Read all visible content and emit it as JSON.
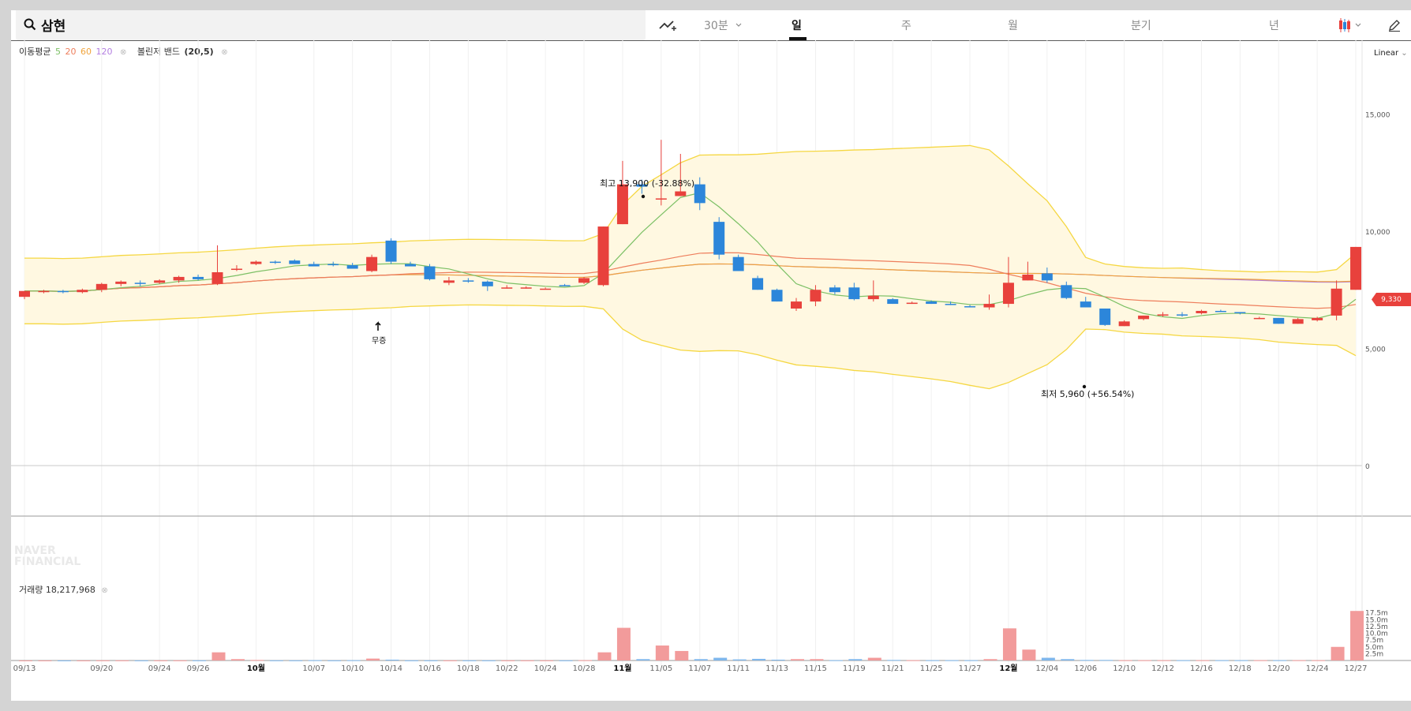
{
  "search": {
    "query": "삼현"
  },
  "toolbar": {
    "interval_label": "30분",
    "tabs": [
      "일",
      "주",
      "월",
      "분기",
      "년"
    ],
    "active_tab": "일"
  },
  "legend": {
    "ma_label": "이동평균",
    "ma_periods": [
      "5",
      "20",
      "60",
      "120"
    ],
    "ma_colors": [
      "#7cc065",
      "#ee7e5c",
      "#f0a43c",
      "#b37ee0"
    ],
    "bb_label": "볼린저 밴드",
    "bb_params": "(20,5)"
  },
  "scale_mode": "Linear",
  "price_axis_ticks": [
    "15,000",
    "10,000",
    "5,000",
    "0"
  ],
  "volume": {
    "label": "거래량",
    "value": "18,217,968"
  },
  "volume_axis_ticks": [
    "17.5m",
    "15.0m",
    "12.5m",
    "10.0m",
    "7.5m",
    "5.0m",
    "2.5m"
  ],
  "last_price_badge": "9,330",
  "annotations": {
    "high": "최고 13,900 (-32.88%)",
    "low": "최저 5,960 (+56.54%)",
    "event": "무증"
  },
  "watermark": [
    "NAVER",
    "FINANCIAL"
  ],
  "colors": {
    "up": "#e8413c",
    "down": "#2c86da",
    "band_fill": "#fff8e1",
    "band_line": "#f5d742"
  },
  "chart_data": {
    "type": "candlestick",
    "x_tick_labels": [
      "09/13",
      "09/20",
      "09/24",
      "09/26",
      "10월",
      "10/07",
      "10/10",
      "10/14",
      "10/16",
      "10/18",
      "10/22",
      "10/24",
      "10/28",
      "11월",
      "11/05",
      "11/07",
      "11/11",
      "11/13",
      "11/15",
      "11/19",
      "11/21",
      "11/25",
      "11/27",
      "12월",
      "12/04",
      "12/06",
      "12/10",
      "12/12",
      "12/16",
      "12/18",
      "12/20",
      "12/24",
      "12/27"
    ],
    "x_tick_index": [
      0,
      4,
      7,
      9,
      12,
      15,
      17,
      19,
      21,
      23,
      25,
      27,
      29,
      31,
      33,
      35,
      37,
      39,
      41,
      43,
      45,
      47,
      49,
      51,
      53,
      55,
      57,
      59,
      61,
      63,
      65,
      67,
      69
    ],
    "ylim": [
      0,
      18500
    ],
    "volume_ylim": [
      0,
      19000000
    ],
    "candles": [
      [
        7200,
        7450,
        7100,
        7450
      ],
      [
        7400,
        7500,
        7350,
        7450
      ],
      [
        7450,
        7500,
        7350,
        7400
      ],
      [
        7400,
        7550,
        7350,
        7500
      ],
      [
        7500,
        7800,
        7400,
        7750
      ],
      [
        7750,
        7900,
        7650,
        7850
      ],
      [
        7800,
        7900,
        7650,
        7750
      ],
      [
        7800,
        7950,
        7750,
        7900
      ],
      [
        7900,
        8100,
        7800,
        8050
      ],
      [
        8050,
        8150,
        7900,
        7950
      ],
      [
        7750,
        9400,
        7700,
        8250
      ],
      [
        8400,
        8550,
        8300,
        8400
      ],
      [
        8600,
        8750,
        8550,
        8700
      ],
      [
        8700,
        8750,
        8600,
        8650
      ],
      [
        8750,
        8800,
        8600,
        8600
      ],
      [
        8600,
        8700,
        8500,
        8500
      ],
      [
        8600,
        8700,
        8500,
        8550
      ],
      [
        8550,
        8650,
        8400,
        8400
      ],
      [
        8300,
        9000,
        8250,
        8900
      ],
      [
        9600,
        9700,
        8600,
        8700
      ],
      [
        8600,
        8700,
        8500,
        8500
      ],
      [
        8500,
        8600,
        7900,
        7950
      ],
      [
        7800,
        8050,
        7700,
        7900
      ],
      [
        7900,
        8000,
        7800,
        7850
      ],
      [
        7850,
        7900,
        7450,
        7650
      ],
      [
        7600,
        7700,
        7550,
        7600
      ],
      [
        7550,
        7650,
        7550,
        7600
      ],
      [
        7550,
        7600,
        7550,
        7550
      ],
      [
        7700,
        7750,
        7650,
        7650
      ],
      [
        7800,
        8050,
        7750,
        8000
      ],
      [
        7700,
        10200,
        7650,
        10200
      ],
      [
        10300,
        13000,
        10300,
        12000
      ],
      [
        12000,
        12200,
        11600,
        11900
      ],
      [
        11400,
        13900,
        11100,
        11400
      ],
      [
        11500,
        13300,
        11500,
        11700
      ],
      [
        12000,
        12300,
        10900,
        11200
      ],
      [
        10400,
        10600,
        8800,
        9000
      ],
      [
        8900,
        9000,
        8300,
        8300
      ],
      [
        8000,
        8100,
        7500,
        7500
      ],
      [
        7500,
        7550,
        7000,
        7000
      ],
      [
        6700,
        7150,
        6600,
        7000
      ],
      [
        7000,
        7700,
        6800,
        7500
      ],
      [
        7600,
        7700,
        7300,
        7400
      ],
      [
        7600,
        7800,
        7050,
        7100
      ],
      [
        7100,
        7900,
        7000,
        7250
      ],
      [
        7100,
        7150,
        6900,
        6900
      ],
      [
        6900,
        7000,
        6900,
        6950
      ],
      [
        7000,
        7050,
        6900,
        6900
      ],
      [
        6900,
        7000,
        6850,
        6850
      ],
      [
        6800,
        6850,
        6750,
        6750
      ],
      [
        6750,
        7300,
        6650,
        6900
      ],
      [
        6900,
        8900,
        6750,
        7800
      ],
      [
        7900,
        8700,
        7900,
        8150
      ],
      [
        8200,
        8450,
        7800,
        7900
      ],
      [
        7700,
        7850,
        7100,
        7150
      ],
      [
        7000,
        7200,
        6750,
        6750
      ],
      [
        6700,
        6700,
        5960,
        6000
      ],
      [
        5950,
        6200,
        5950,
        6150
      ],
      [
        6250,
        6400,
        6200,
        6400
      ],
      [
        6400,
        6550,
        6350,
        6450
      ],
      [
        6450,
        6550,
        6350,
        6400
      ],
      [
        6500,
        6650,
        6450,
        6600
      ],
      [
        6600,
        6650,
        6550,
        6550
      ],
      [
        6550,
        6550,
        6450,
        6500
      ],
      [
        6300,
        6350,
        6250,
        6300
      ],
      [
        6300,
        6300,
        6050,
        6050
      ],
      [
        6050,
        6300,
        6050,
        6250
      ],
      [
        6200,
        6350,
        6150,
        6300
      ],
      [
        6400,
        7900,
        6200,
        7550
      ],
      [
        7500,
        9330,
        7500,
        9330
      ]
    ],
    "volumes": [
      0.02,
      0.02,
      0.02,
      0.02,
      0.05,
      0.05,
      0.04,
      0.05,
      0.05,
      0.05,
      3.0,
      0.5,
      0.2,
      0.05,
      0.05,
      0.1,
      0.05,
      0.1,
      0.7,
      0.3,
      0.05,
      0.05,
      0.05,
      0.05,
      0.05,
      0.05,
      0.05,
      0.05,
      0.05,
      0.1,
      3.0,
      12.0,
      0.5,
      5.5,
      3.5,
      0.5,
      1.0,
      0.4,
      0.6,
      0.3,
      0.5,
      0.5,
      0.1,
      0.5,
      1.0,
      0.2,
      0.1,
      0.1,
      0.1,
      0.1,
      0.5,
      11.8,
      4.0,
      1.0,
      0.5,
      0.2,
      0.2,
      0.1,
      0.1,
      0.1,
      0.1,
      0.1,
      0.1,
      0.1,
      0.1,
      0.1,
      0.1,
      0.1,
      5.0,
      18.2
    ]
  }
}
